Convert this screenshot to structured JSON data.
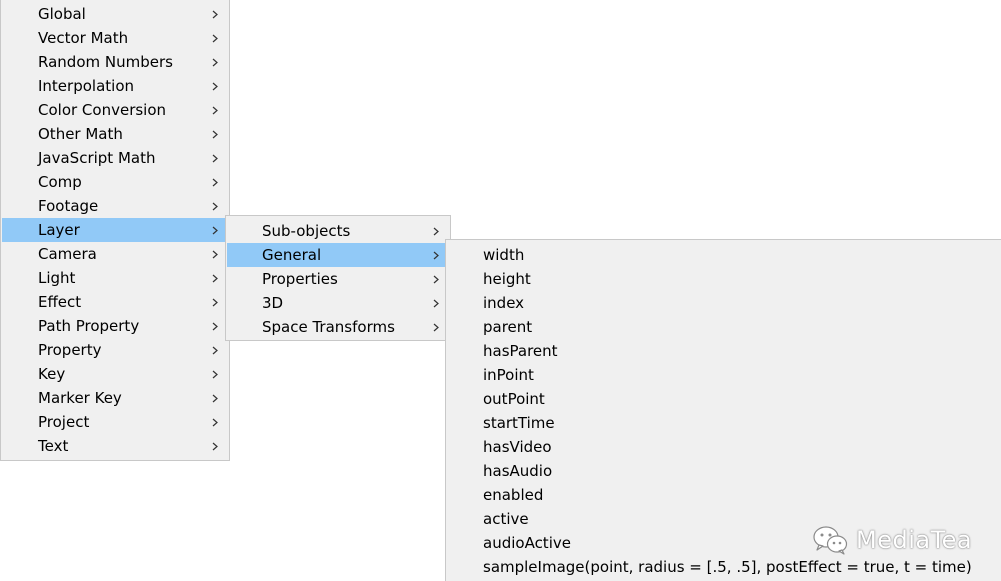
{
  "main_menu": {
    "items": [
      {
        "label": "Global",
        "has_submenu": true,
        "selected": false
      },
      {
        "label": "Vector Math",
        "has_submenu": true,
        "selected": false
      },
      {
        "label": "Random Numbers",
        "has_submenu": true,
        "selected": false
      },
      {
        "label": "Interpolation",
        "has_submenu": true,
        "selected": false
      },
      {
        "label": "Color Conversion",
        "has_submenu": true,
        "selected": false
      },
      {
        "label": "Other Math",
        "has_submenu": true,
        "selected": false
      },
      {
        "label": "JavaScript Math",
        "has_submenu": true,
        "selected": false
      },
      {
        "label": "Comp",
        "has_submenu": true,
        "selected": false
      },
      {
        "label": "Footage",
        "has_submenu": true,
        "selected": false
      },
      {
        "label": "Layer",
        "has_submenu": true,
        "selected": true
      },
      {
        "label": "Camera",
        "has_submenu": true,
        "selected": false
      },
      {
        "label": "Light",
        "has_submenu": true,
        "selected": false
      },
      {
        "label": "Effect",
        "has_submenu": true,
        "selected": false
      },
      {
        "label": "Path Property",
        "has_submenu": true,
        "selected": false
      },
      {
        "label": "Property",
        "has_submenu": true,
        "selected": false
      },
      {
        "label": "Key",
        "has_submenu": true,
        "selected": false
      },
      {
        "label": "Marker Key",
        "has_submenu": true,
        "selected": false
      },
      {
        "label": "Project",
        "has_submenu": true,
        "selected": false
      },
      {
        "label": "Text",
        "has_submenu": true,
        "selected": false
      }
    ]
  },
  "layer_menu": {
    "items": [
      {
        "label": "Sub-objects",
        "has_submenu": true,
        "selected": false
      },
      {
        "label": "General",
        "has_submenu": true,
        "selected": true
      },
      {
        "label": "Properties",
        "has_submenu": true,
        "selected": false
      },
      {
        "label": "3D",
        "has_submenu": true,
        "selected": false
      },
      {
        "label": "Space Transforms",
        "has_submenu": true,
        "selected": false
      }
    ]
  },
  "general_menu": {
    "items": [
      {
        "label": "width"
      },
      {
        "label": "height"
      },
      {
        "label": "index"
      },
      {
        "label": "parent"
      },
      {
        "label": "hasParent"
      },
      {
        "label": "inPoint"
      },
      {
        "label": "outPoint"
      },
      {
        "label": "startTime"
      },
      {
        "label": "hasVideo"
      },
      {
        "label": "hasAudio"
      },
      {
        "label": "enabled"
      },
      {
        "label": "active"
      },
      {
        "label": "audioActive"
      },
      {
        "label": "sampleImage(point, radius = [.5, .5], postEffect = true, t = time)"
      }
    ]
  },
  "watermark": {
    "icon": "wechat-icon",
    "text": "MediaTea"
  },
  "colors": {
    "menu_background": "#f0f0f0",
    "menu_border": "#c8c8c8",
    "selection": "#91c9f7",
    "page_background": "#ffffff"
  }
}
